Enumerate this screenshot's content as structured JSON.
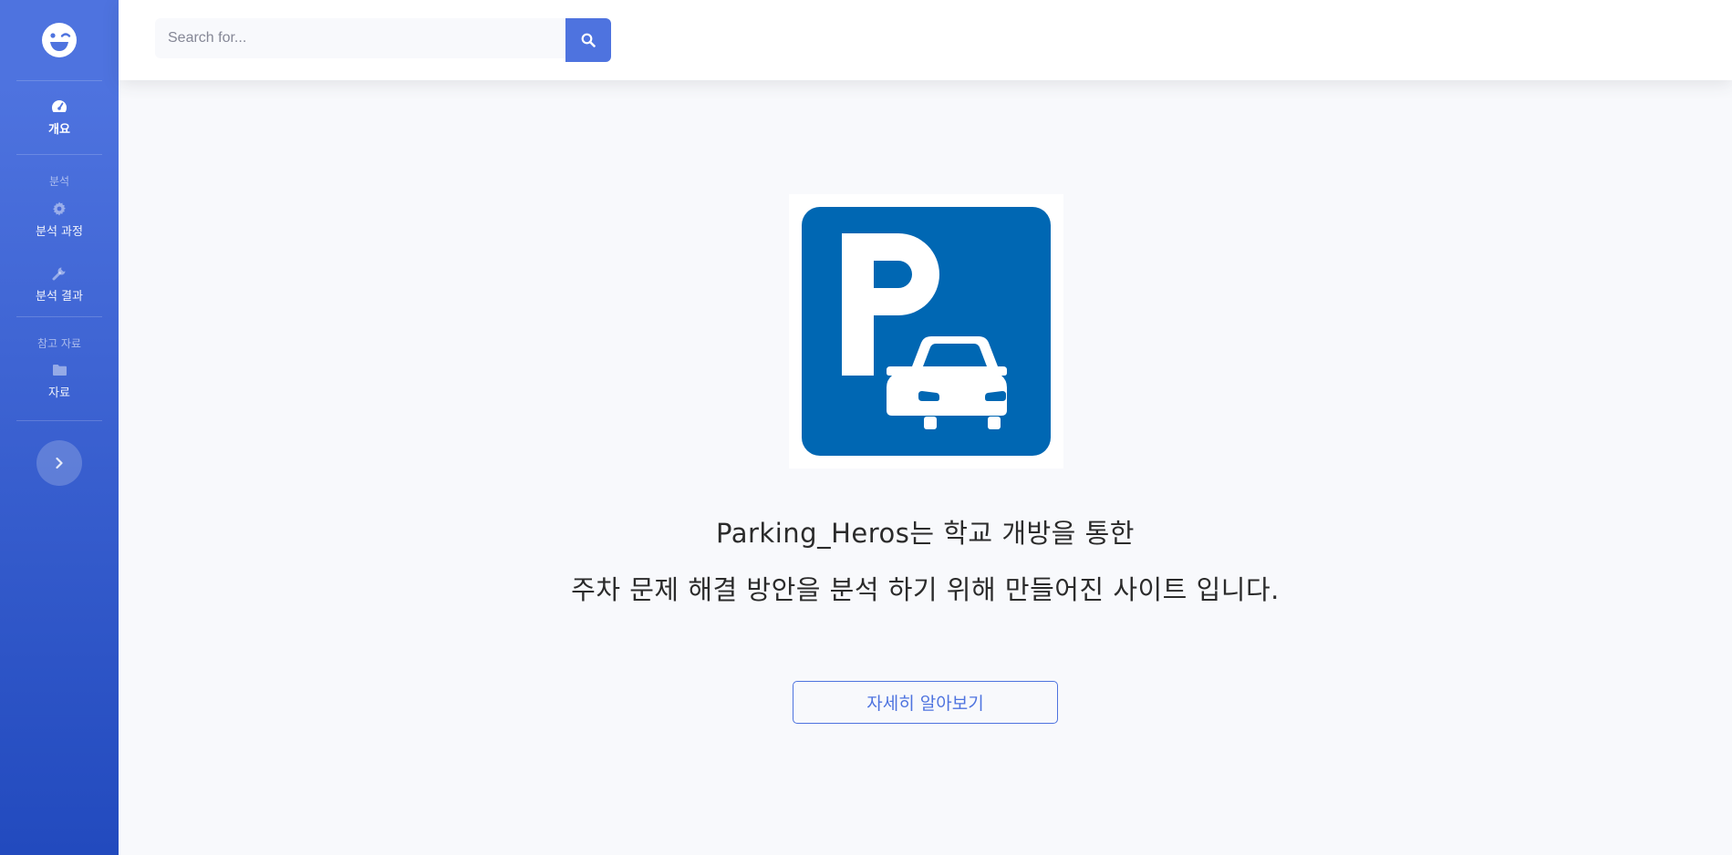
{
  "sidebar": {
    "brand_icon": "laugh-wink-icon",
    "items": [
      {
        "label": "개요",
        "icon": "tachometer-icon",
        "active": true
      },
      {
        "label": "분석 과정",
        "icon": "gear-icon"
      },
      {
        "label": "분석 결과",
        "icon": "wrench-icon"
      },
      {
        "label": "자료",
        "icon": "folder-icon"
      }
    ],
    "headings": [
      "분석",
      "참고 자료"
    ],
    "toggle_icon": "chevron-right-icon"
  },
  "topbar": {
    "search": {
      "placeholder": "Search for...",
      "value": "",
      "button_icon": "search-icon"
    }
  },
  "main": {
    "image_icon": "parking-sign-icon",
    "headline_line1": "Parking_Heros는 학교 개방을 통한",
    "headline_line2": "주차 문제 해결 방안을 분석 하기 위해 만들어진 사이트 입니다.",
    "cta_label": "자세히 알아보기"
  },
  "colors": {
    "primary": "#4e73df",
    "sidebar_gradient_end": "#224abe",
    "parking_blue": "#0067b3",
    "background": "#f8f9fc"
  }
}
